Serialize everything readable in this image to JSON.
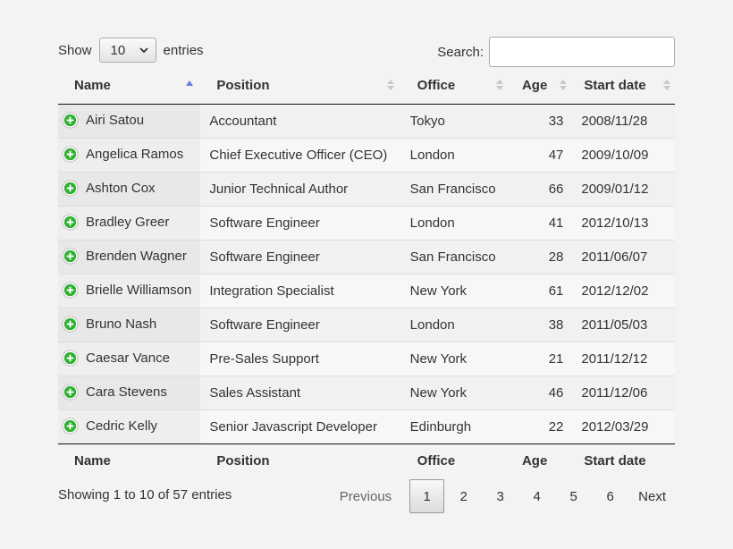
{
  "length": {
    "prefix": "Show",
    "value": "10",
    "suffix": "entries"
  },
  "search": {
    "label": "Search:",
    "value": "",
    "placeholder": ""
  },
  "columns": [
    "Name",
    "Position",
    "Office",
    "Age",
    "Start date"
  ],
  "sort": {
    "column": "Name",
    "direction": "ascending",
    "active_color": "#6b7fd7"
  },
  "rows": [
    {
      "name": "Airi Satou",
      "position": "Accountant",
      "office": "Tokyo",
      "age": "33",
      "start": "2008/11/28"
    },
    {
      "name": "Angelica Ramos",
      "position": "Chief Executive Officer (CEO)",
      "office": "London",
      "age": "47",
      "start": "2009/10/09"
    },
    {
      "name": "Ashton Cox",
      "position": "Junior Technical Author",
      "office": "San Francisco",
      "age": "66",
      "start": "2009/01/12"
    },
    {
      "name": "Bradley Greer",
      "position": "Software Engineer",
      "office": "London",
      "age": "41",
      "start": "2012/10/13"
    },
    {
      "name": "Brenden Wagner",
      "position": "Software Engineer",
      "office": "San Francisco",
      "age": "28",
      "start": "2011/06/07"
    },
    {
      "name": "Brielle Williamson",
      "position": "Integration Specialist",
      "office": "New York",
      "age": "61",
      "start": "2012/12/02"
    },
    {
      "name": "Bruno Nash",
      "position": "Software Engineer",
      "office": "London",
      "age": "38",
      "start": "2011/05/03"
    },
    {
      "name": "Caesar Vance",
      "position": "Pre-Sales Support",
      "office": "New York",
      "age": "21",
      "start": "2011/12/12"
    },
    {
      "name": "Cara Stevens",
      "position": "Sales Assistant",
      "office": "New York",
      "age": "46",
      "start": "2011/12/06"
    },
    {
      "name": "Cedric Kelly",
      "position": "Senior Javascript Developer",
      "office": "Edinburgh",
      "age": "22",
      "start": "2012/03/29"
    }
  ],
  "expand_icon": {
    "name": "plus-circle-icon",
    "color": "#31b131"
  },
  "info": "Showing 1 to 10 of 57 entries",
  "pagination": {
    "previous": "Previous",
    "pages": [
      "1",
      "2",
      "3",
      "4",
      "5",
      "6"
    ],
    "current": "1",
    "next": "Next"
  }
}
